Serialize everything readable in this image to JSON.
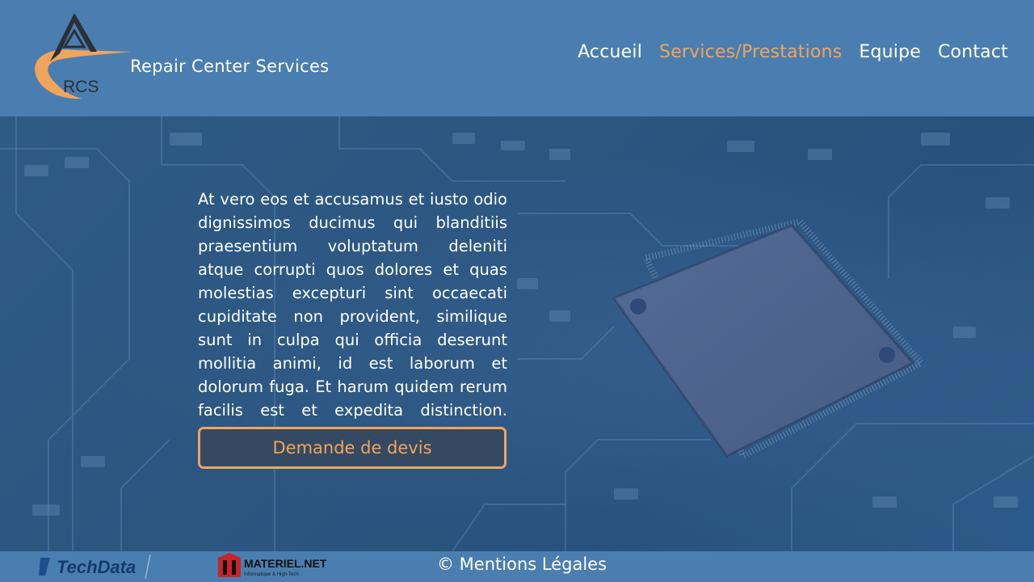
{
  "header": {
    "logo_text": "RCS",
    "brand": "Repair Center Services"
  },
  "nav": {
    "items": [
      {
        "label": "Accueil"
      },
      {
        "label": "Services/Prestations"
      },
      {
        "label": "Equipe"
      },
      {
        "label": "Contact"
      }
    ],
    "active": "Services/Prestations"
  },
  "hero": {
    "paragraph": "At vero eos et accusamus et iusto odio dignissimos ducimus qui blanditiis praesentium voluptatum deleniti atque corrupti quos dolores et quas molestias excepturi sint occaecati cupiditate non provident, similique sunt in culpa qui officia deserunt mollitia animi, id est laborum et dolorum fuga. Et harum quidem rerum facilis est et expedita distinction. maiores alias consequatur aut",
    "cta_label": "Demande de devis"
  },
  "footer": {
    "partner1": "TechData",
    "partner2": "MATERIEL.NET",
    "partner2_tagline": "Informatique & High-Tech",
    "legal": "© Mentions Légales"
  },
  "colors": {
    "header_bg": "#4a7eb0",
    "accent": "#f0a45c",
    "hero_bg": "#2d5984"
  }
}
